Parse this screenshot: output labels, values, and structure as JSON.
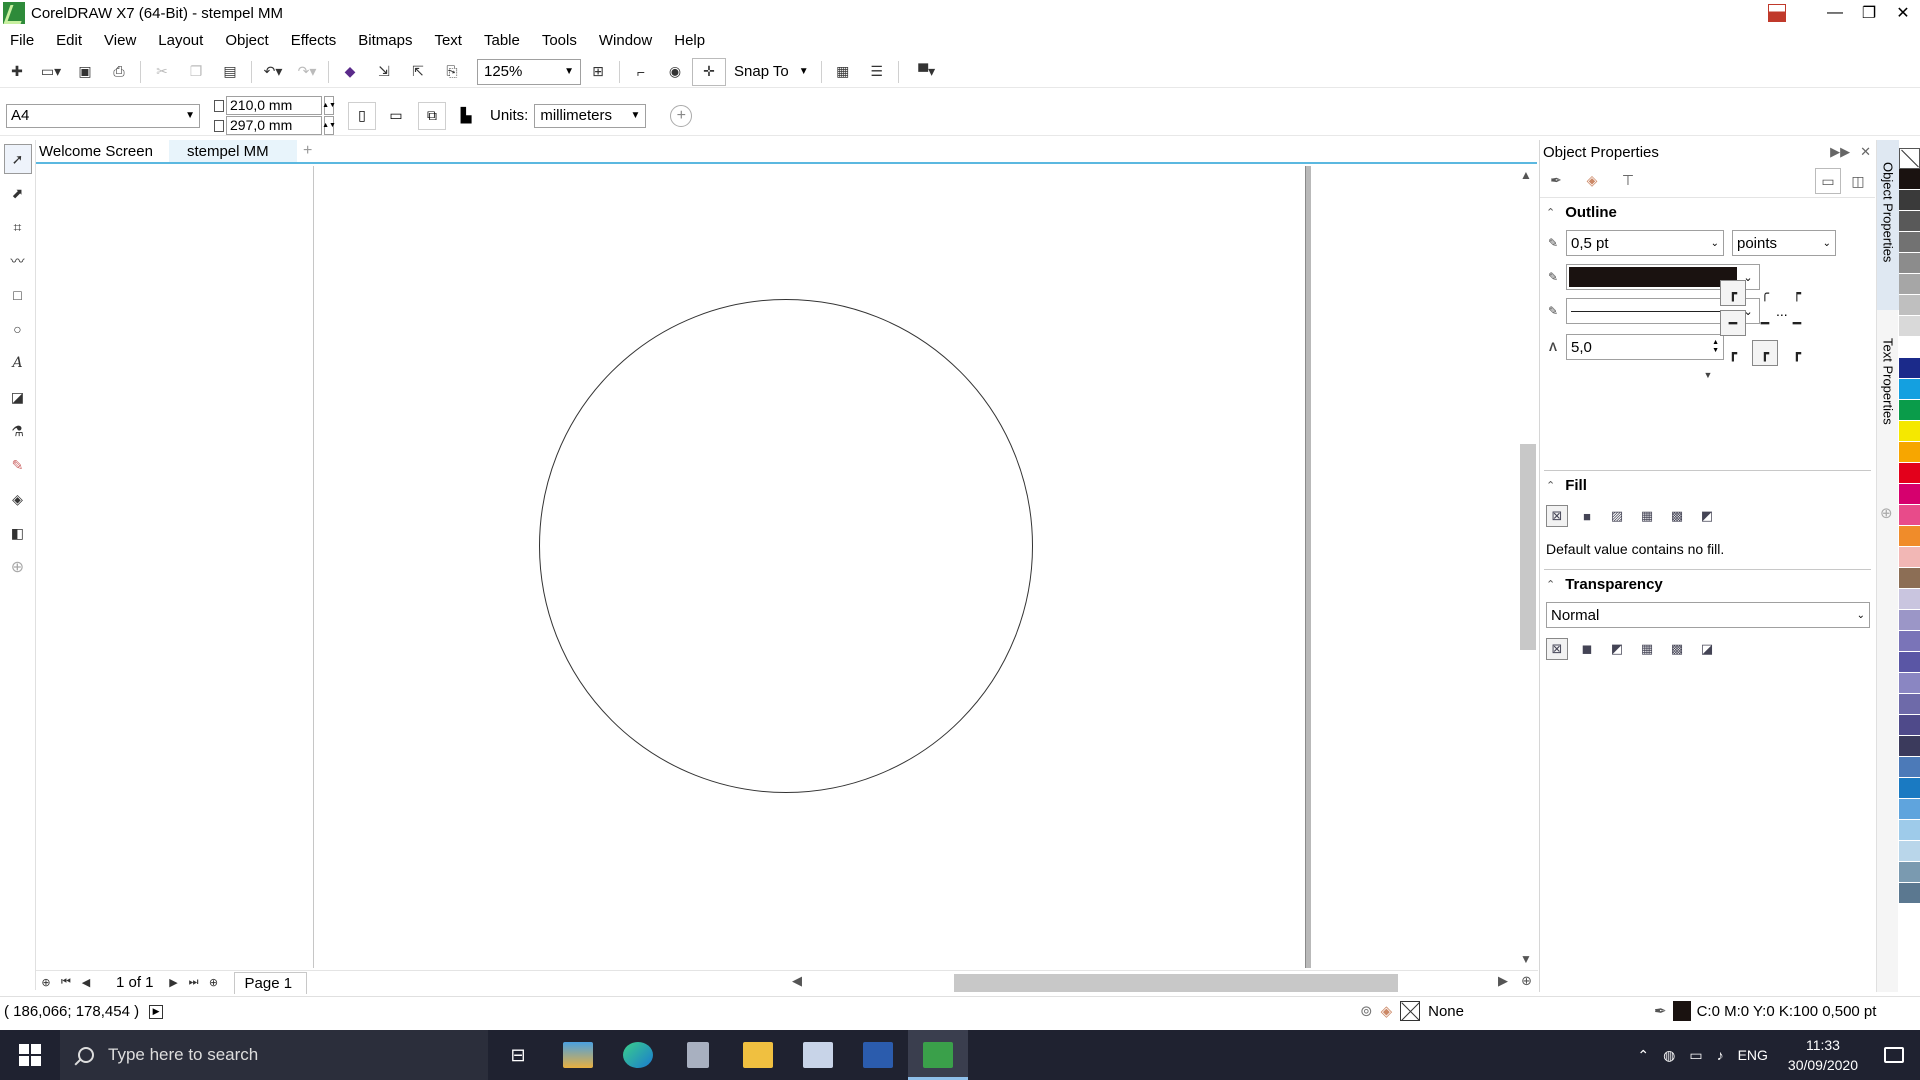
{
  "window": {
    "title": "CorelDRAW X7 (64-Bit) - stempel MM",
    "minimize": "—",
    "maximize": "❐",
    "close": "✕"
  },
  "menu": [
    "File",
    "Edit",
    "View",
    "Layout",
    "Object",
    "Effects",
    "Bitmaps",
    "Text",
    "Table",
    "Tools",
    "Window",
    "Help"
  ],
  "toolbar": {
    "zoom_value": "125%",
    "snap_label": "Snap To"
  },
  "property_bar": {
    "paper_size": "A4",
    "width": "210,0 mm",
    "height": "297,0 mm",
    "units_label": "Units:",
    "units_value": "millimeters"
  },
  "document_tabs": [
    "Welcome Screen",
    "stempel MM"
  ],
  "page_navigator": {
    "count": "1 of 1",
    "page_tab": "Page 1"
  },
  "status_bar": {
    "coordinates": "( 186,066; 178,454 )",
    "fill_label": "None",
    "outline_label": "C:0 M:0 Y:0 K:100  0,500 pt"
  },
  "docker": {
    "title": "Object Properties",
    "outline": {
      "heading": "Outline",
      "width_value": "0,5 pt",
      "width_units": "points",
      "more_label": "...",
      "miter_value": "5,0"
    },
    "fill": {
      "heading": "Fill",
      "message": "Default value contains no fill."
    },
    "transparency": {
      "heading": "Transparency",
      "mode": "Normal"
    }
  },
  "docker_tabs": [
    "Object Properties",
    "Text Properties"
  ],
  "palette_colors": [
    "#1a1210",
    "#3a3a3a",
    "#595959",
    "#727272",
    "#8c8c8c",
    "#a6a6a6",
    "#bfbfbf",
    "#d9d9d9",
    "#ffffff",
    "#1b2a8a",
    "#14a0e0",
    "#0a9c4a",
    "#f5e800",
    "#f7a600",
    "#e3001b",
    "#d6006e",
    "#e84b8a",
    "#f08c2a",
    "#f2b7b5",
    "#8c6e55",
    "#c9c5df",
    "#9b96c7",
    "#7a74b8",
    "#5a56a5",
    "#8a86c2",
    "#6e6aa9",
    "#4f4a8a",
    "#3b3a5c",
    "#4c7ab8",
    "#1a7ac2",
    "#5fa4dd",
    "#9ecbea",
    "#b9d6ea",
    "#7a9ab0",
    "#5b7890"
  ],
  "taskbar": {
    "search_placeholder": "Type here to search",
    "language": "ENG",
    "time": "11:33",
    "date": "30/09/2020"
  }
}
